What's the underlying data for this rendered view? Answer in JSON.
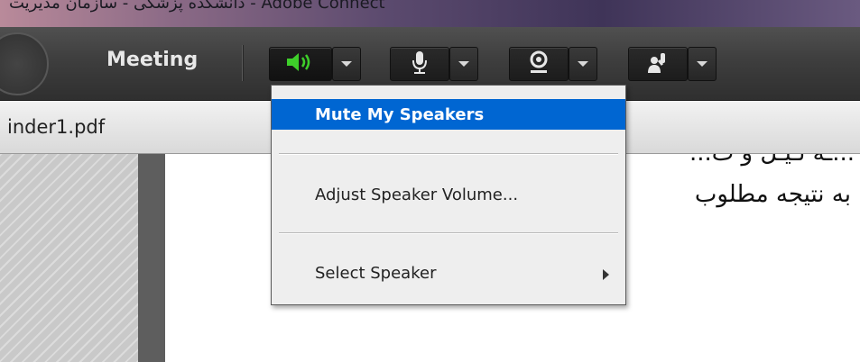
{
  "window": {
    "title": "دانشکده پزشکی - سازمان مدیریت - Adobe Connect"
  },
  "toolbar": {
    "meeting_label": "Meeting",
    "buttons": [
      {
        "icon": "speaker-icon",
        "active": true
      },
      {
        "icon": "microphone-icon",
        "active": false
      },
      {
        "icon": "webcam-icon",
        "active": false
      },
      {
        "icon": "raise-hand-icon",
        "active": false
      }
    ]
  },
  "tabbar": {
    "file_name": "inder1.pdf"
  },
  "document": {
    "line1": "...ـه ئـيـل و ت...",
    "line2": "به نتیجه مطلوب"
  },
  "menu": {
    "items": [
      {
        "label": "Mute My Speakers",
        "highlighted": true
      },
      {
        "label": "Adjust Speaker Volume...",
        "highlighted": false
      },
      {
        "label": "Select Speaker",
        "highlighted": false,
        "has_submenu": true
      }
    ]
  },
  "colors": {
    "highlight": "#0066d2",
    "speaker_active": "#3ecf2a",
    "toolbar_bg": "#3e3e3e"
  }
}
